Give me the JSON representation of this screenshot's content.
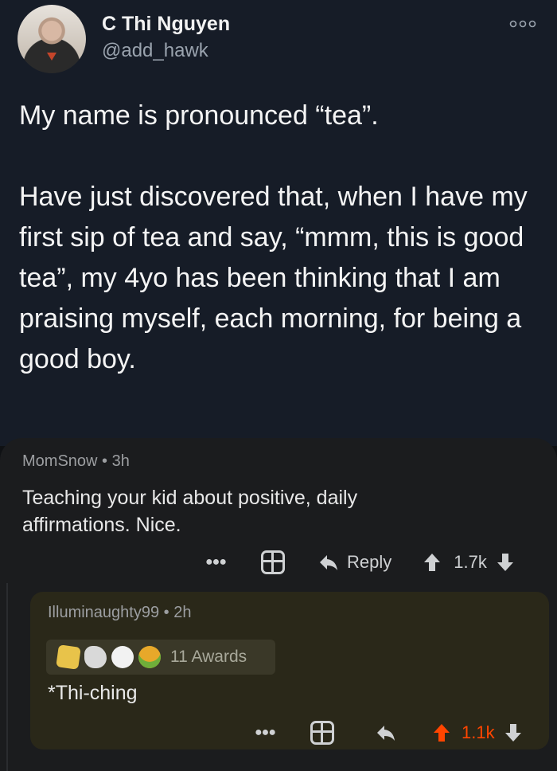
{
  "tweet": {
    "display_name": "C Thi Nguyen",
    "handle": "@add_hawk",
    "text": "My name is pronounced “tea”.\n\nHave just discovered that, when I have my first sip of tea and say, “mmm, this is good tea”, my 4yo has been thinking that I am praising myself, each morning, for being a good boy."
  },
  "comment": {
    "username": "MomSnow",
    "time": "3h",
    "text": "Teaching your kid about positive, daily affirmations.  Nice.",
    "reply_label": "Reply",
    "score": "1.7k"
  },
  "reply": {
    "username": "Illuminaughty99",
    "time": "2h",
    "awards_label": "11 Awards",
    "text": "*Thi-ching",
    "score": "1.1k"
  },
  "colors": {
    "upvote_active": "#ff4500",
    "tweet_bg": "#161c27",
    "card_bg": "#1b1c1e",
    "nested_bg": "#2a2819"
  },
  "icons": [
    "more-icon",
    "gift-icon",
    "reply-icon",
    "upvote-icon",
    "downvote-icon",
    "award-icons"
  ]
}
